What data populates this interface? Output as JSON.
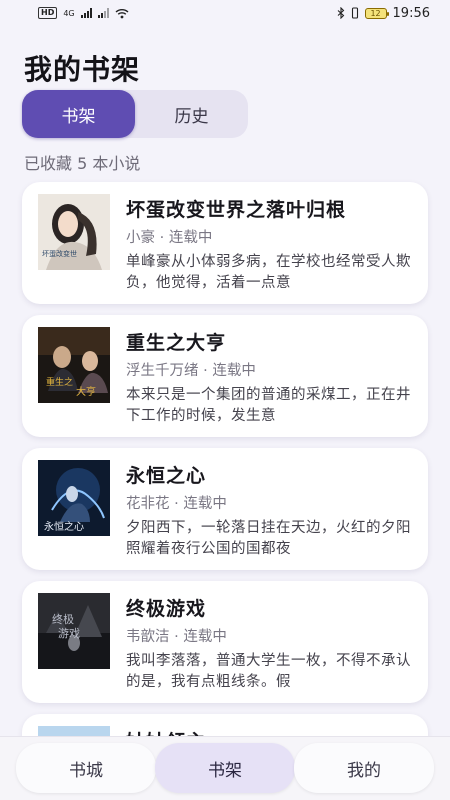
{
  "status_bar": {
    "left_tag": "HD",
    "net_label": "4G",
    "battery": "12",
    "time": "19:56"
  },
  "header": {
    "title": "我的书架"
  },
  "tabs": [
    {
      "label": "书架",
      "active": true
    },
    {
      "label": "历史",
      "active": false
    }
  ],
  "collection_count_text": "已收藏 5 本小说",
  "books": [
    {
      "title": "坏蛋改变世界之落叶归根",
      "meta": "小豪 · 连载中",
      "description": "单峰豪从小体弱多病，在学校也经常受人欺负，他觉得，活着一点意",
      "cover_style": "light"
    },
    {
      "title": "重生之大亨",
      "meta": "浮生千万绪 · 连载中",
      "description": "本来只是一个集团的普通的采煤工，正在井下工作的时候，发生意",
      "cover_style": "dark-warm"
    },
    {
      "title": "永恒之心",
      "meta": "花非花 · 连载中",
      "description": "夕阳西下，一轮落日挂在天边，火红的夕阳照耀着夜行公国的国都夜",
      "cover_style": "dark-blue"
    },
    {
      "title": "终极游戏",
      "meta": "韦歆洁 · 连载中",
      "description": "我叫李落落，普通大学生一枚，不得不承认的是，我有点粗线条。假",
      "cover_style": "dark-gray"
    },
    {
      "title": "姑姑领主",
      "meta": "",
      "description": "",
      "cover_style": "light-blue"
    }
  ],
  "bottom_nav": [
    {
      "label": "书城",
      "active": false
    },
    {
      "label": "书架",
      "active": true
    },
    {
      "label": "我的",
      "active": false
    }
  ]
}
